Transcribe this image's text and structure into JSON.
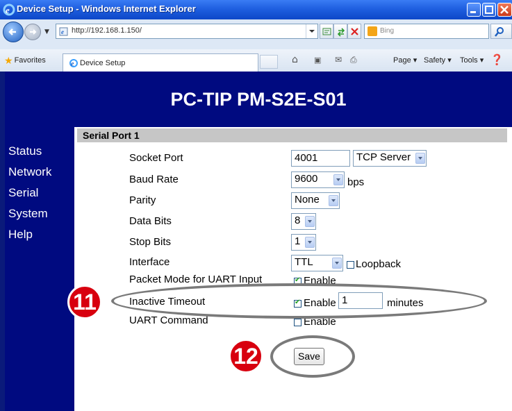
{
  "window": {
    "title": "Device Setup - Windows Internet Explorer",
    "address": "http://192.168.1.150/",
    "search_placeholder": "Bing",
    "favorites_label": "Favorites",
    "tab_title": "Device Setup",
    "commands": {
      "page": "Page ▾",
      "safety": "Safety ▾",
      "tools": "Tools ▾"
    }
  },
  "banner": {
    "title": "PC-TIP PM-S2E-S01"
  },
  "sidebar": {
    "items": [
      {
        "label": "Status"
      },
      {
        "label": "Network"
      },
      {
        "label": "Serial"
      },
      {
        "label": "System"
      },
      {
        "label": "Help"
      }
    ]
  },
  "section": {
    "title": "Serial Port 1"
  },
  "form": {
    "socket_port": {
      "label": "Socket Port",
      "value": "4001",
      "mode": "TCP Server"
    },
    "baud_rate": {
      "label": "Baud Rate",
      "value": "9600",
      "unit": "bps"
    },
    "parity": {
      "label": "Parity",
      "value": "None"
    },
    "data_bits": {
      "label": "Data Bits",
      "value": "8"
    },
    "stop_bits": {
      "label": "Stop Bits",
      "value": "1"
    },
    "interface": {
      "label": "Interface",
      "value": "TTL",
      "loopback_label": "Loopback",
      "loopback_checked": false
    },
    "packet_mode": {
      "label": "Packet Mode for UART Input",
      "enable_label": "Enable",
      "checked": true
    },
    "inactive_timeout": {
      "label": "Inactive Timeout",
      "enable_label": "Enable",
      "checked": true,
      "value": "1",
      "unit": "minutes"
    },
    "uart_command": {
      "label": "UART Command",
      "enable_label": "Enable",
      "checked": false
    },
    "save_label": "Save"
  },
  "annotations": {
    "step_11": "11",
    "step_12": "12"
  }
}
